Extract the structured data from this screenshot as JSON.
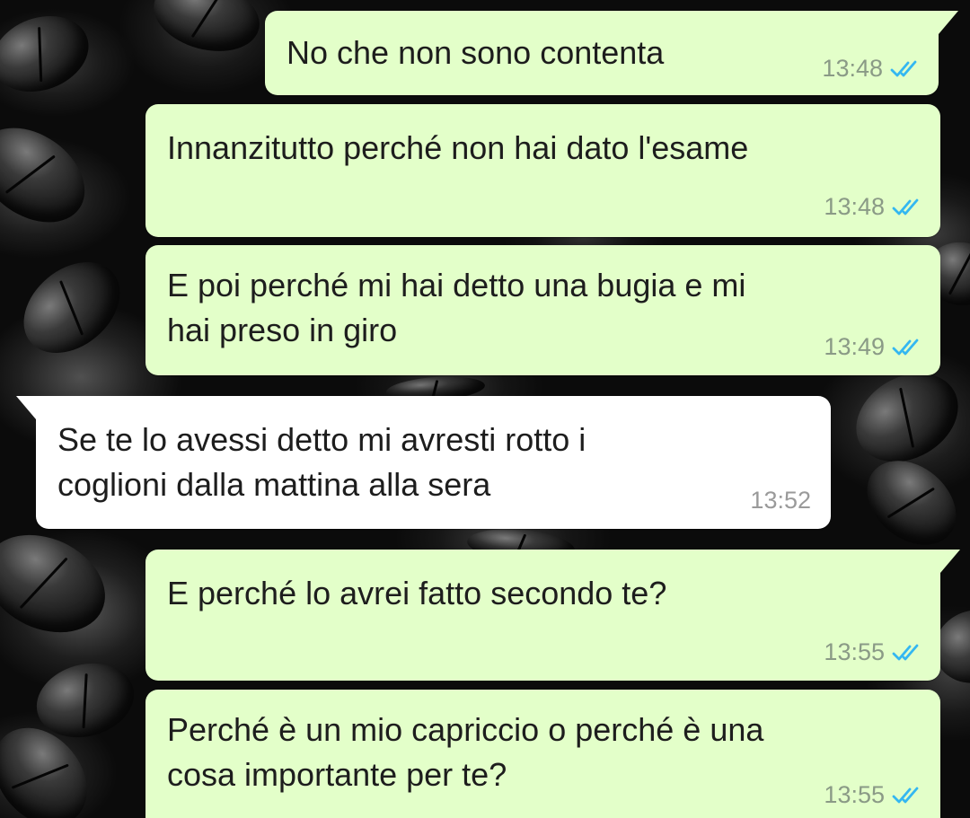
{
  "chat": {
    "wallpaper": "coffee-beans-dark",
    "colors": {
      "outgoing_bubble": "#e3ffc9",
      "incoming_bubble": "#ffffff",
      "read_ticks": "#34b7f1"
    },
    "messages": [
      {
        "direction": "outgoing",
        "text": "No che non sono contenta",
        "time": "13:48",
        "status": "read"
      },
      {
        "direction": "outgoing",
        "text": "Innanzitutto perché non hai dato l'esame",
        "time": "13:48",
        "status": "read"
      },
      {
        "direction": "outgoing",
        "text": "E poi perché mi hai detto una bugia e mi\nhai preso in giro",
        "time": "13:49",
        "status": "read"
      },
      {
        "direction": "incoming",
        "text": "Se te lo avessi detto mi avresti rotto i\ncoglioni dalla mattina alla sera",
        "time": "13:52"
      },
      {
        "direction": "outgoing",
        "text": "E perché lo avrei fatto secondo te?",
        "time": "13:55",
        "status": "read"
      },
      {
        "direction": "outgoing",
        "text": "Perché è un mio capriccio o perché è una\ncosa importante per te?",
        "time": "13:55",
        "status": "read"
      }
    ]
  }
}
